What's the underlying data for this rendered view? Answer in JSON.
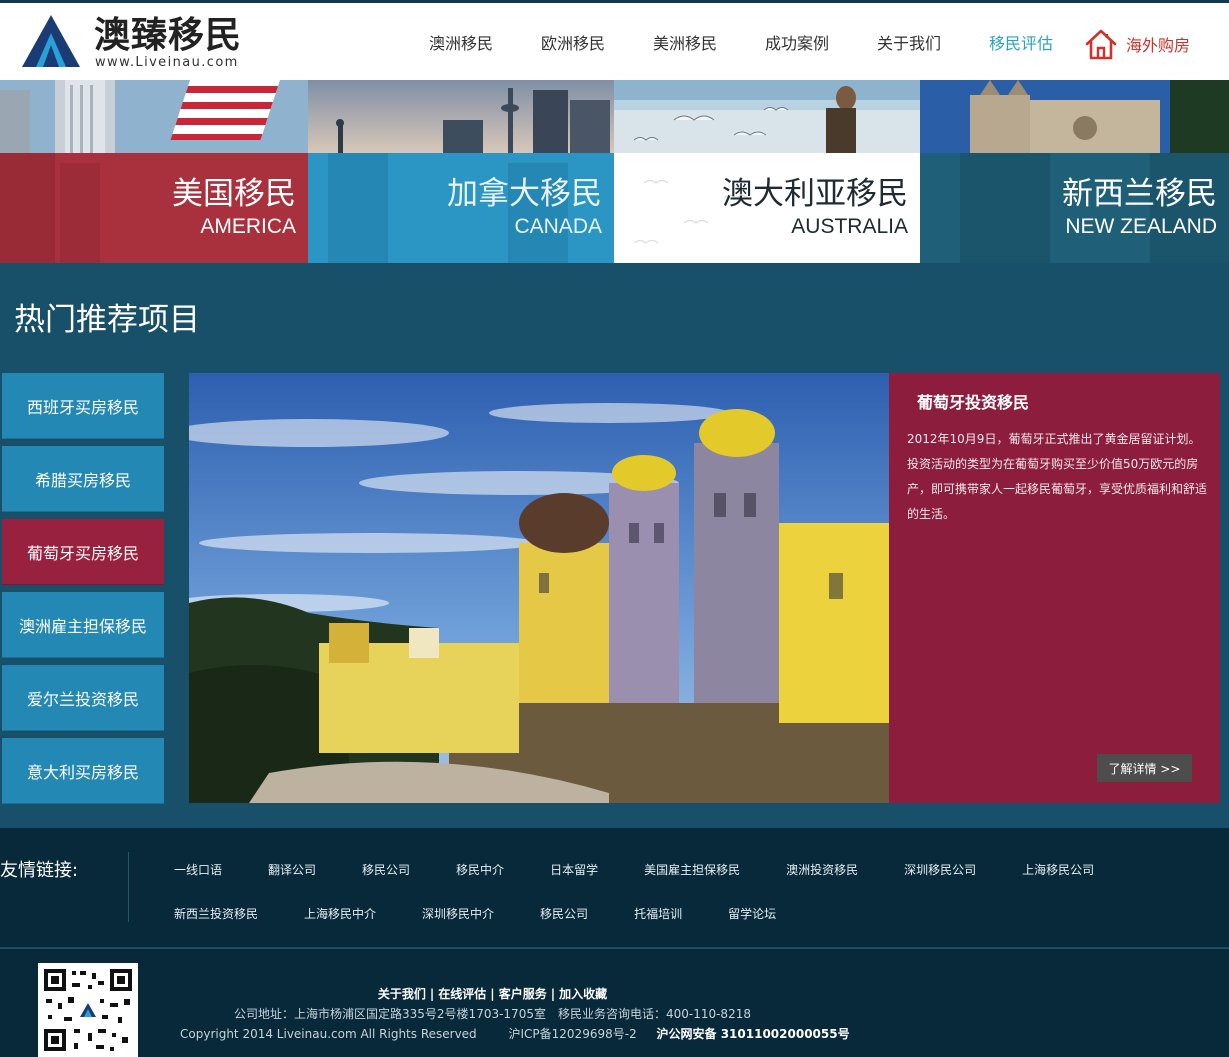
{
  "brand": {
    "title": "澳臻移民",
    "url": "www.Liveinau.com"
  },
  "nav": {
    "items": [
      "澳洲移民",
      "欧洲移民",
      "美洲移民",
      "成功案例",
      "关于我们",
      "移民评估"
    ],
    "active_index": 5,
    "shop_label": "海外购房",
    "shop_icon": "house-icon"
  },
  "banner": {
    "tiles": [
      {
        "cn": "美国移民",
        "en": "AMERICA",
        "panel_color": "#a8313d",
        "text_color": "#ffffff"
      },
      {
        "cn": "加拿大移民",
        "en": "CANADA",
        "panel_color": "#2b95c4",
        "text_color": "#e8f3f8"
      },
      {
        "cn": "澳大利亚移民",
        "en": "AUSTRALIA",
        "panel_color": "#ffffff",
        "text_color": "#1d2a32"
      },
      {
        "cn": "新西兰移民",
        "en": "NEW ZEALAND",
        "panel_color": "#1f5f77",
        "text_color": "#ffffff"
      }
    ]
  },
  "section": {
    "title": "热门推荐项目"
  },
  "side_list": {
    "items": [
      "西班牙买房移民",
      "希腊买房移民",
      "葡萄牙买房移民",
      "澳洲雇主担保移民",
      "爱尔兰投资移民",
      "意大利买房移民"
    ],
    "active_index": 2
  },
  "feature": {
    "title": "葡萄牙投资移民",
    "description": "2012年10月9日，葡萄牙正式推出了黄金居留证计划。投资活动的类型为在葡萄牙购买至少价值50万欧元的房产，即可携带家人一起移民葡萄牙，享受优质福利和舒适的生活。",
    "more_label": "了解详情 >>"
  },
  "friend_links": {
    "label": "友情链接:",
    "row1": [
      "一线口语",
      "翻译公司",
      "移民公司",
      "移民中介",
      "日本留学",
      "美国雇主担保移民",
      "澳洲投资移民",
      "深圳移民公司",
      "上海移民公司"
    ],
    "row2": [
      "新西兰投资移民",
      "上海移民中介",
      "深圳移民中介",
      "移民公司",
      "托福培训",
      "留学论坛"
    ]
  },
  "footer": {
    "links": [
      "关于我们",
      "在线评估",
      "客户服务",
      "加入收藏"
    ],
    "address": "公司地址：上海市杨浦区国定路335号2号楼1703-1705室　移民业务咨询电话：400-110-8218",
    "copyright": "Copyright 2014 Liveinau.com All Rights Reserved",
    "icp": "沪ICP备12029698号-2",
    "police": "沪公网安备 31011002000055号"
  },
  "colors": {
    "page_bg": "#175068",
    "side_item": "#2388b3",
    "side_active": "#98213f",
    "feature_panel": "#8c1d3c",
    "footer_bg": "#08293a",
    "nav_active": "#2aa0c8",
    "shop": "#d0322a"
  }
}
